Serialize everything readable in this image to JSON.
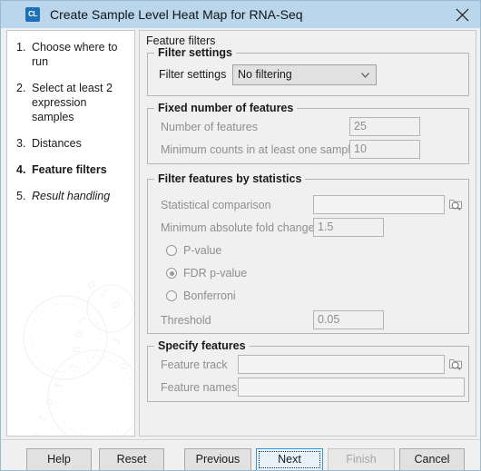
{
  "window": {
    "title": "Create Sample Level Heat Map for RNA-Seq",
    "icon_text": "CL",
    "close_icon": "close-icon"
  },
  "sidebar": {
    "steps": [
      {
        "num": "1.",
        "label": "Choose where to run",
        "state": "done"
      },
      {
        "num": "2.",
        "label": "Select at least 2 expression samples",
        "state": "done"
      },
      {
        "num": "3.",
        "label": "Distances",
        "state": "done"
      },
      {
        "num": "4.",
        "label": "Feature filters",
        "state": "current"
      },
      {
        "num": "5.",
        "label": "Result handling",
        "state": "pending"
      }
    ]
  },
  "main": {
    "panel_title": "Feature filters",
    "groups": {
      "filter_settings": {
        "title": "Filter settings",
        "label": "Filter settings",
        "selected": "No filtering",
        "options": [
          "No filtering"
        ]
      },
      "fixed_number": {
        "title": "Fixed number of features",
        "number_of_features_label": "Number of features",
        "number_of_features_value": "25",
        "minimum_counts_label": "Minimum counts in at least one sample",
        "minimum_counts_value": "10"
      },
      "statistics": {
        "title": "Filter features by statistics",
        "statistical_comparison_label": "Statistical comparison",
        "statistical_comparison_value": "",
        "fold_change_label": "Minimum absolute fold change",
        "fold_change_value": "1.5",
        "radios": [
          {
            "label": "P-value",
            "checked": false
          },
          {
            "label": "FDR p-value",
            "checked": true
          },
          {
            "label": "Bonferroni",
            "checked": false
          }
        ],
        "threshold_label": "Threshold",
        "threshold_value": "0.05"
      },
      "specify_features": {
        "title": "Specify features",
        "feature_track_label": "Feature track",
        "feature_track_value": "",
        "feature_names_label": "Feature names",
        "feature_names_value": ""
      }
    }
  },
  "buttons": {
    "help": "Help",
    "reset": "Reset",
    "previous": "Previous",
    "next": "Next",
    "finish": "Finish",
    "cancel": "Cancel"
  },
  "colors": {
    "titlebar": "#b9d6ea",
    "accent": "#1d6fb8",
    "focus": "#3399dd",
    "panel": "#f0f0f0"
  }
}
